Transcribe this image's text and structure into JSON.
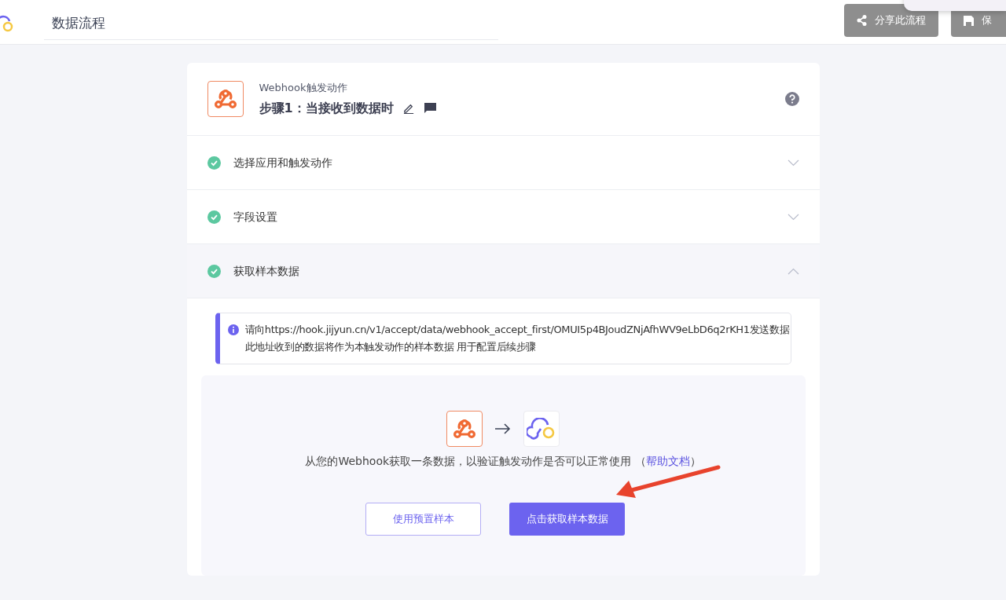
{
  "header": {
    "title": "数据流程",
    "buttons": [
      {
        "kind": "share",
        "label": "分享此流程",
        "disabled": true
      },
      {
        "kind": "save",
        "label": "保",
        "disabled": true
      }
    ]
  },
  "step": {
    "app": "Webhook触发动作",
    "title": "步骤1：当接收到数据时"
  },
  "sections": [
    {
      "title": "选择应用和触发动作",
      "done": true,
      "expanded": false
    },
    {
      "title": "字段设置",
      "done": true,
      "expanded": false
    },
    {
      "title": "获取样本数据",
      "done": true,
      "expanded": true
    }
  ],
  "info": {
    "lines": [
      "请向https://hook.jijyun.cn/v1/accept/data/webhook_accept_first/OMUI5p4BJoudZNjAfhWV9eLbD6q2rKH1发送数据",
      "此地址收到的数据将作为本触发动作的样本数据 用于配置后续步骤"
    ]
  },
  "sample": {
    "description": "从您的Webhook获取一条数据，以验证触发动作是否可以正常使用",
    "link_open": "（",
    "link": "帮助文档",
    "link_close": "）",
    "buttons": [
      {
        "kind": "outline",
        "label": "使用预置样本"
      },
      {
        "kind": "primary",
        "label": "点击获取样本数据"
      }
    ]
  }
}
